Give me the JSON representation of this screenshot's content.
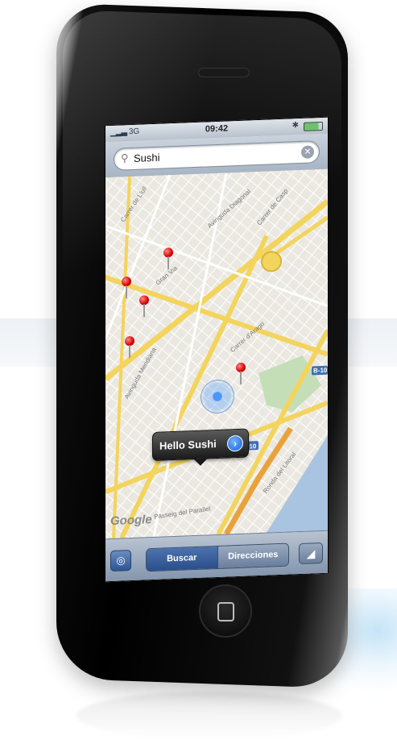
{
  "status_bar": {
    "carrier": "3G",
    "time": "09:42"
  },
  "search": {
    "query": "Sushi"
  },
  "map": {
    "callout_label": "Hello Sushi",
    "attribution": "Google",
    "streets": [
      "Carrer de Llull",
      "Avinguda Diagonal",
      "Carrer de Casp",
      "Gran Via",
      "Ronda del Litoral",
      "Passeig del Parallel",
      "Avinguda Meridiana",
      "Carrer d'Arago"
    ],
    "road_badges": [
      "B-10",
      "B-10"
    ]
  },
  "toolbar": {
    "segments": [
      "Buscar",
      "Direcciones"
    ]
  },
  "colors": {
    "pin_red": "#d50000",
    "toolbar_blue": "#2a4f8a",
    "road_yellow": "#f3d45c"
  }
}
